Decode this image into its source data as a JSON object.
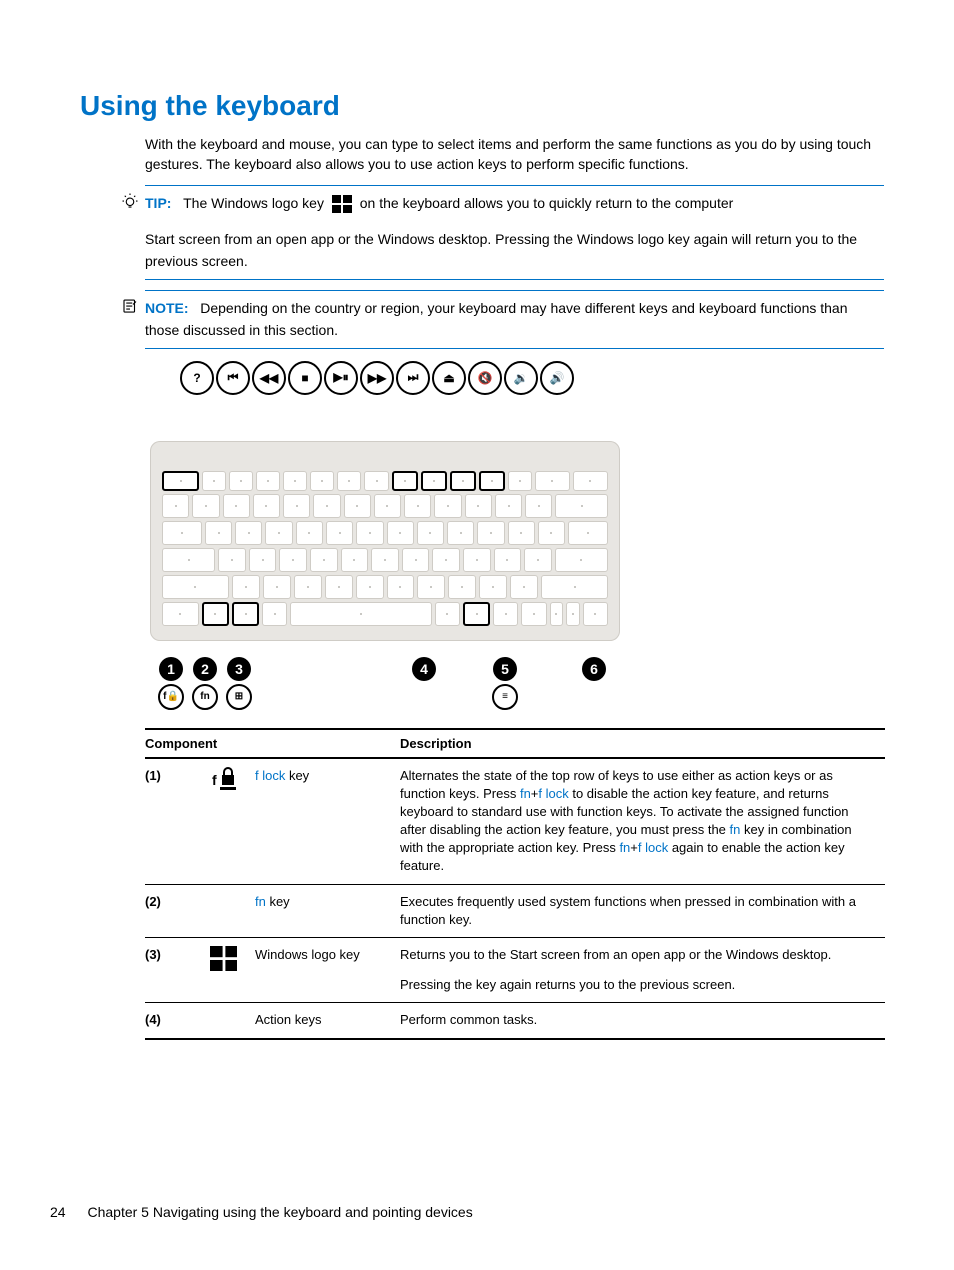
{
  "heading": "Using the keyboard",
  "intro": "With the keyboard and mouse, you can type to select items and perform the same functions as you do by using touch gestures. The keyboard also allows you to use action keys to perform specific functions.",
  "tip": {
    "label": "TIP:",
    "pre": "The Windows logo key",
    "mid": "on the keyboard allows you to quickly return to the computer",
    "body2": "Start screen from an open app or the Windows desktop. Pressing the Windows logo key again will return you to the previous screen."
  },
  "note": {
    "label": "NOTE:",
    "body": "Depending on the country or region, your keyboard may have different keys and keyboard functions than those discussed in this section."
  },
  "action_icons": [
    "?",
    "⏮",
    "◀◀",
    "■",
    "▶⏸",
    "▶▶",
    "⏭",
    "⏏",
    "🔇",
    "🔉",
    "🔊"
  ],
  "marker_groups": [
    {
      "num": "1",
      "icon": "f🔒",
      "offset": 0
    },
    {
      "num": "2",
      "icon": "fn",
      "offset": 0
    },
    {
      "num": "3",
      "icon": "⊞",
      "offset": 0
    },
    {
      "num": "4",
      "icon": "",
      "offset": 152
    },
    {
      "num": "5",
      "icon": "≡",
      "offset": 48
    },
    {
      "num": "6",
      "icon": "",
      "offset": 56
    }
  ],
  "table": {
    "headers": {
      "component": "Component",
      "description": "Description"
    },
    "rows": [
      {
        "num": "(1)",
        "icon": "flock",
        "comp_html": [
          "f lock",
          " key"
        ],
        "desc_parts": [
          {
            "t": "Alternates the state of the top row of keys to use either as action keys or as function keys. Press "
          },
          {
            "t": "fn",
            "c": "b"
          },
          {
            "t": "+"
          },
          {
            "t": "f lock",
            "c": "b"
          },
          {
            "t": " to disable the action key feature, and returns keyboard to standard use with function keys. To activate the assigned function after disabling the action key feature, you must press the "
          },
          {
            "t": "fn",
            "c": "b"
          },
          {
            "t": " key in combination with the appropriate action key. Press "
          },
          {
            "t": "fn",
            "c": "b"
          },
          {
            "t": "+"
          },
          {
            "t": "f lock",
            "c": "b"
          },
          {
            "t": " again to enable the action key feature."
          }
        ]
      },
      {
        "num": "(2)",
        "icon": "",
        "comp_html": [
          "fn",
          " key"
        ],
        "desc_parts": [
          {
            "t": "Executes frequently used system functions when pressed in combination with a function key."
          }
        ]
      },
      {
        "num": "(3)",
        "icon": "win",
        "comp_plain": "Windows logo key",
        "desc_parts": [
          {
            "t": "Returns you to the Start screen from an open app or the Windows desktop."
          },
          {
            "t": "\n\nPressing the key again returns you to the previous screen."
          }
        ]
      },
      {
        "num": "(4)",
        "icon": "",
        "comp_plain": "Action keys",
        "desc_parts": [
          {
            "t": "Perform common tasks."
          }
        ]
      }
    ]
  },
  "footer": {
    "page": "24",
    "chapter": "Chapter 5   Navigating using the keyboard and pointing devices"
  }
}
